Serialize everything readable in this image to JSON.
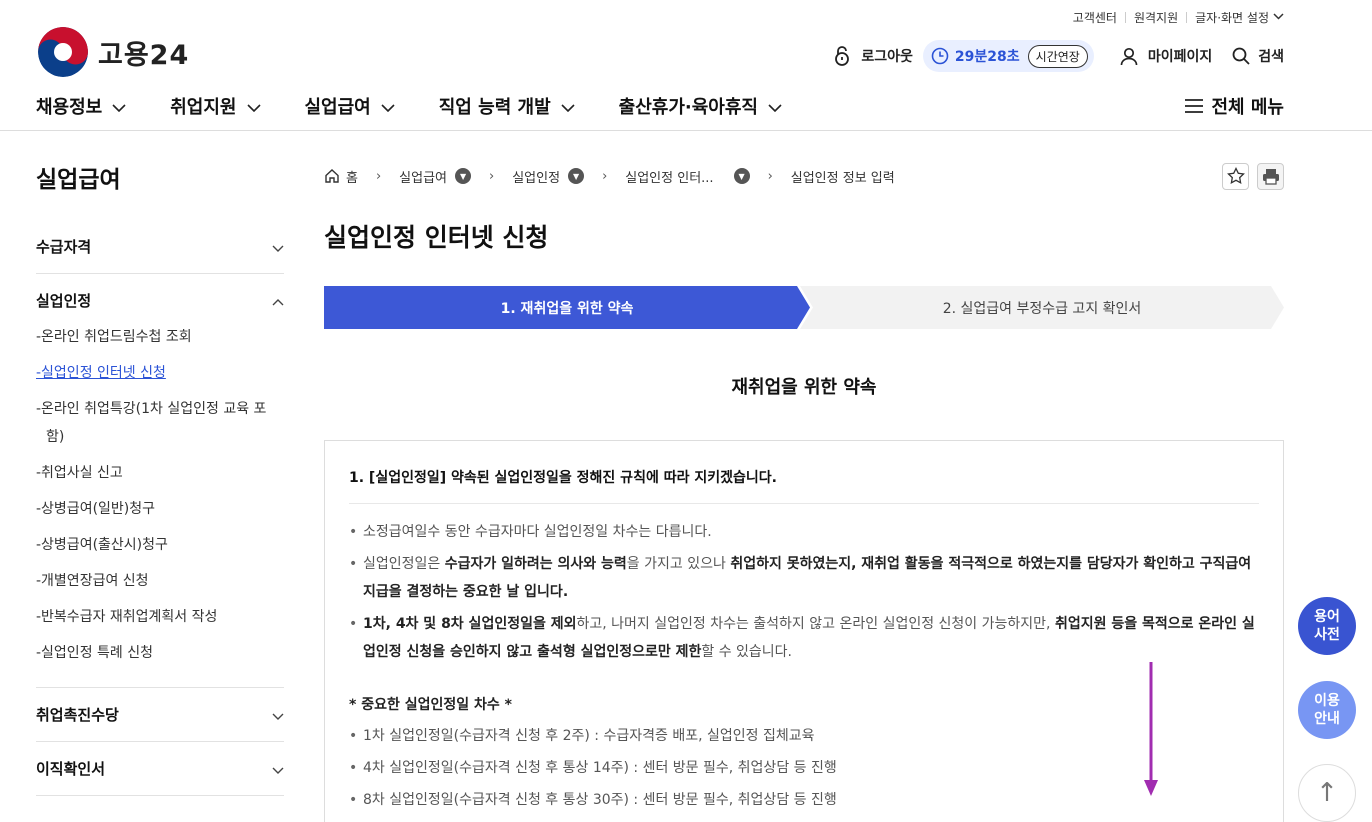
{
  "utility_links": [
    "고객센터",
    "원격지원",
    "글자·화면 설정"
  ],
  "logo": {
    "name": "고용24"
  },
  "session": {
    "logout": "로그아웃",
    "time": "29분28초",
    "extend": "시간연장"
  },
  "header_actions": {
    "mypage": "마이페이지",
    "search": "검색"
  },
  "gnb": {
    "items": [
      "채용정보",
      "취업지원",
      "실업급여",
      "직업 능력 개발",
      "출산휴가·육아휴직"
    ],
    "all_menu": "전체 메뉴"
  },
  "sidebar": {
    "title": "실업급여",
    "groups": [
      {
        "label": "수급자격",
        "expanded": false
      },
      {
        "label": "실업인정",
        "expanded": true,
        "items": [
          "-온라인 취업드림수첩 조회",
          "-실업인정 인터넷 신청",
          "-온라인 취업특강(1차 실업인정 교육 포함)",
          "-취업사실 신고",
          "-상병급여(일반)청구",
          "-상병급여(출산시)청구",
          "-개별연장급여 신청",
          "-반복수급자 재취업계획서 작성",
          "-실업인정 특례 신청"
        ]
      },
      {
        "label": "취업촉진수당",
        "expanded": false
      },
      {
        "label": "이직확인서",
        "expanded": false
      }
    ]
  },
  "breadcrumb": [
    "홈",
    "실업급여",
    "실업인정",
    "실업인정 인터...",
    "실업인정 정보 입력"
  ],
  "page_title": "실업인정 인터넷 신청",
  "steps": [
    "1. 재취업을 위한 약속",
    "2. 실업급여 부정수급 고지 확인서"
  ],
  "section_title": "재취업을 위한 약속",
  "content": {
    "heading": "1. [실업인정일] 약속된 실업인정일을 정해진 규칙에 따라 지키겠습니다.",
    "b1": "소정급여일수 동안 수급자마다 실업인정일 차수는 다릅니다.",
    "b2": {
      "t1": "실업인정일은 ",
      "s1": "수급자가 일하려는 의사와 능력",
      "t2": "을 가지고 있으나 ",
      "s2": "취업하지 못하였는지, 재취업 활동을 적극적으로 하였는지를 담당자가 확인하고 구직급여 지급을 결정하는 중요한 날 입니다."
    },
    "b3": {
      "s1": "1차, 4차 및 8차 실업인정일을 제외",
      "t1": "하고, 나머지 실업인정 차수는 출석하지 않고 온라인 실업인정 신청이 가능하지만, ",
      "s2": "취업지원 등을 목적으로 온라인 실업인정 신청을 승인하지 않고 출석형 실업인정으로만 제한",
      "t2": "할 수 있습니다."
    },
    "important_title": "* 중요한 실업인정일 차수 *",
    "important": [
      "1차 실업인정일(수급자격 신청 후 2주) : 수급자격증 배포, 실업인정 집체교육",
      "4차 실업인정일(수급자격 신청 후 통상 14주) : 센터 방문 필수, 취업상담 등 진행",
      "8차 실업인정일(수급자격 신청 후 통상 30주) : 센터 방문 필수, 취업상담 등 진행"
    ]
  },
  "floating": {
    "dictionary": [
      "용어",
      "사전"
    ],
    "guide": [
      "이용",
      "안내"
    ],
    "top": "↑"
  },
  "colors": {
    "primary": "#3d58d6",
    "accent_arrow": "#a12db0"
  }
}
